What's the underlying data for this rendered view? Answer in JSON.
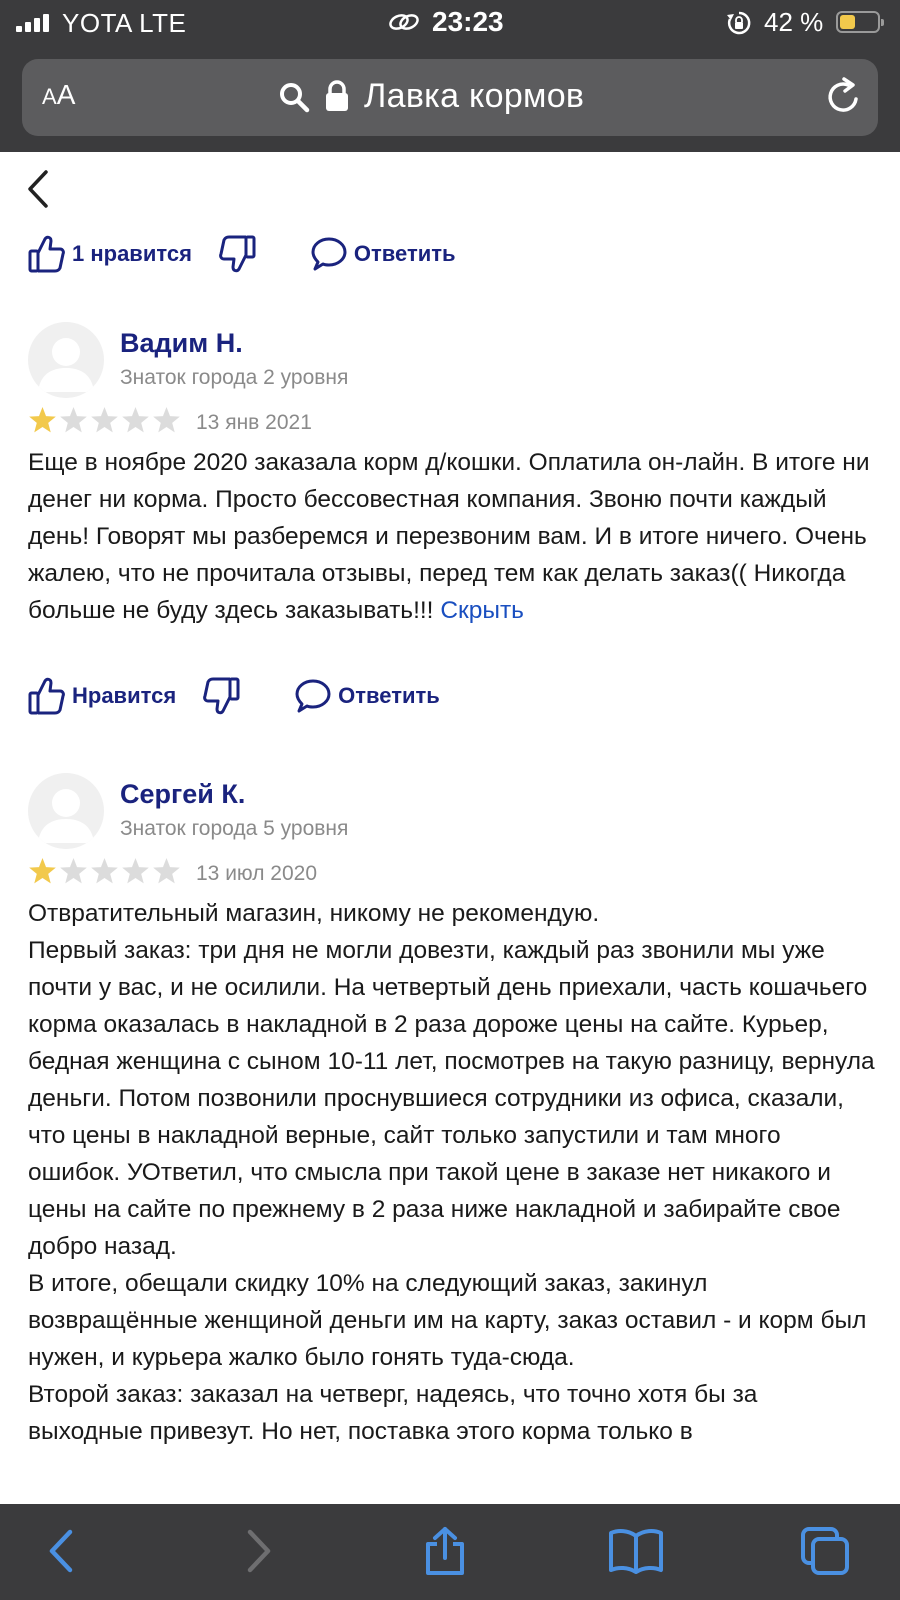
{
  "status_bar": {
    "carrier": "YOTA   LTE",
    "time": "23:23",
    "battery_percent": "42 %",
    "battery_level": 0.42,
    "icons": [
      "signal-icon",
      "link-icon",
      "rotation-lock-icon",
      "battery-icon"
    ]
  },
  "browser": {
    "text_size_label": "AA",
    "site_title": "Лавка кормов",
    "icons": [
      "search-icon",
      "padlock-icon",
      "reload-icon"
    ]
  },
  "nav": {
    "back_icon": "chevron-left-icon"
  },
  "top_actions": {
    "like_label": "1 нравится",
    "reply_label": "Ответить"
  },
  "reviews": [
    {
      "author": "Вадим Н.",
      "level": "Знаток города 2 уровня",
      "rating": 1,
      "rating_max": 5,
      "date": "13 янв 2021",
      "text": "Еще в ноябре 2020 заказала корм д/кошки. Оплатила он-лайн. В итоге ни денег ни корма. Просто бессовестная компания. Звоню почти каждый день! Говорят мы разберемся и перезвоним вам. И в итоге ничего. Очень жалею, что не прочитала отзывы, перед тем как делать заказ(( Никогда больше не буду здесь заказывать!!! ",
      "hide_label": "Скрыть",
      "like_label": "Нравится",
      "reply_label": "Ответить"
    },
    {
      "author": "Сергей К.",
      "level": "Знаток города 5 уровня",
      "rating": 1,
      "rating_max": 5,
      "date": "13 июл 2020",
      "text": "Отвратительный магазин, никому не рекомендую.\nПервый заказ: три дня не могли довезти, каждый раз звонили мы уже почти у вас, и не осилили. На четвертый день приехали, часть кошачьего корма оказалась в накладной в 2 раза дороже цены на сайте. Курьер, бедная женщина с сыном 10-11 лет, посмотрев на такую разницу, вернула деньги. Потом позвонили проснувшиеся сотрудники из офиса, сказали, что цены в накладной верные, сайт только запустили и там много ошибок. УОтветил, что смысла при такой цене в заказе нет никакого и цены на сайте по прежнему в 2 раза ниже накладной и забирайте свое добро назад.\nВ итоге, обещали скидку 10% на следующий заказ, закинул возвращённые женщиной деньги им на карту, заказ оставил - и корм был нужен, и курьера жалко было гонять туда-сюда.\nВторой заказ: заказал на четверг, надеясь, что точно хотя бы за выходные привезут. Но нет, поставка этого корма только в"
    }
  ],
  "toolbar": {
    "icons": [
      "back-arrow-icon",
      "forward-arrow-icon",
      "share-icon",
      "bookmarks-icon",
      "tabs-icon"
    ]
  },
  "colors": {
    "chrome": "#3b3b3d",
    "url_field": "#5c5c5e",
    "action_blue": "#1a237e",
    "link_blue": "#1a4fc0",
    "star_filled": "#f2c94c",
    "star_empty": "#dcdcdc",
    "toolbar_icon": "#4a90e2"
  }
}
